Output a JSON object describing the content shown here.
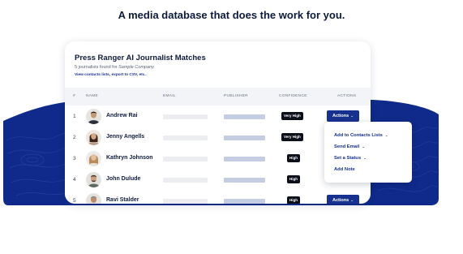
{
  "headline": "A media database that does the work for you.",
  "card": {
    "title": "Press Ranger AI Journalist Matches",
    "subtitle_prefix": "5 journalists found for ",
    "subtitle_company": "Sample Company",
    "link": "View contacts lists, export to CSV, etc."
  },
  "table": {
    "headers": {
      "num": "#",
      "name": "NAME",
      "email": "EMAIL",
      "publisher": "PUBLISHER",
      "confidence": "CONFIDENCE",
      "actions": "ACTIONS"
    },
    "rows": [
      {
        "num": "1",
        "name": "Andrew Rai",
        "confidence": "Very High",
        "action": "Actions"
      },
      {
        "num": "2",
        "name": "Jenny Angells",
        "confidence": "Very High"
      },
      {
        "num": "3",
        "name": "Kathryn Johnson",
        "confidence": "High"
      },
      {
        "num": "4",
        "name": "John Dulude",
        "confidence": "High"
      },
      {
        "num": "5",
        "name": "Ravi Stalder",
        "confidence": "High",
        "action": "Actions"
      }
    ]
  },
  "menu": {
    "items": [
      {
        "label": "Add to Contacts Lists",
        "has_chevron": true
      },
      {
        "label": "Send Email",
        "has_chevron": true
      },
      {
        "label": "Set a Status",
        "has_chevron": true
      },
      {
        "label": "Add Note",
        "has_chevron": false
      }
    ]
  },
  "colors": {
    "navy_band": "#0f2a8a",
    "button_blue": "#17318f",
    "badge_black": "#0b0f1a",
    "text_dark": "#0d1b3d"
  },
  "icons": {
    "chevron": "chevron-down-icon",
    "avatar": "avatar"
  }
}
